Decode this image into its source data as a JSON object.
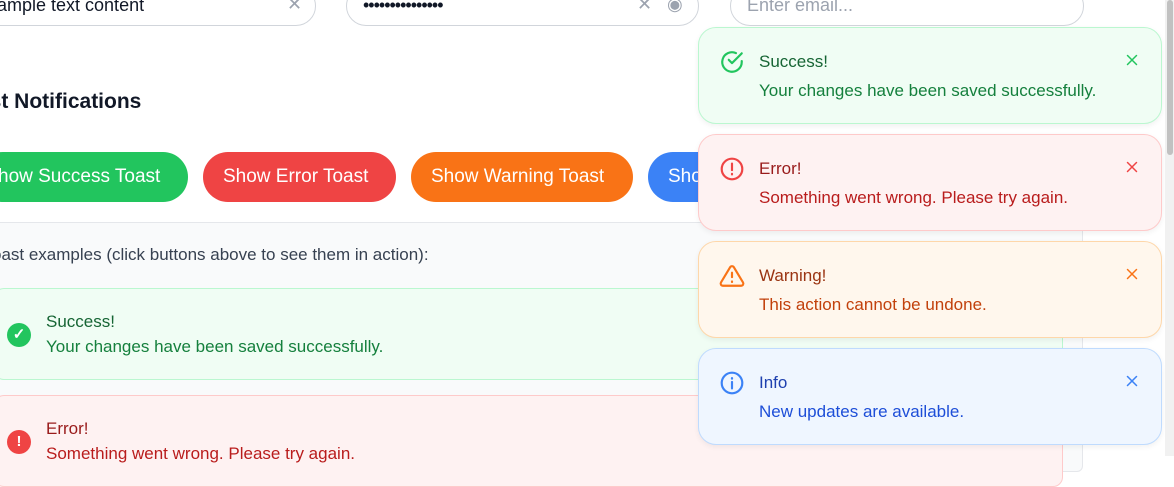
{
  "inputs": {
    "text_value": "ample text content",
    "password_value": "•••••••••••••••",
    "email_placeholder": "Enter email..."
  },
  "section": {
    "title": "ast Notifications"
  },
  "buttons": {
    "success": "how Success Toast",
    "error": "Show Error Toast",
    "warning": "Show Warning Toast",
    "info": "Sho"
  },
  "examples": {
    "intro": "oast examples (click buttons above to see them in action):",
    "success": {
      "title": "Success!",
      "message": "Your changes have been saved successfully."
    },
    "error": {
      "title": "Error!",
      "message": "Something went wrong. Please try again."
    }
  },
  "toasts": [
    {
      "type": "success",
      "title": "Success!",
      "message": "Your changes have been saved successfully."
    },
    {
      "type": "error",
      "title": "Error!",
      "message": "Something went wrong. Please try again."
    },
    {
      "type": "warning",
      "title": "Warning!",
      "message": "This action cannot be undone."
    },
    {
      "type": "info",
      "title": "Info",
      "message": "New updates are available."
    }
  ],
  "colors": {
    "success": "#22c55e",
    "error": "#ef4444",
    "warning": "#f97316",
    "info": "#3b82f6"
  }
}
